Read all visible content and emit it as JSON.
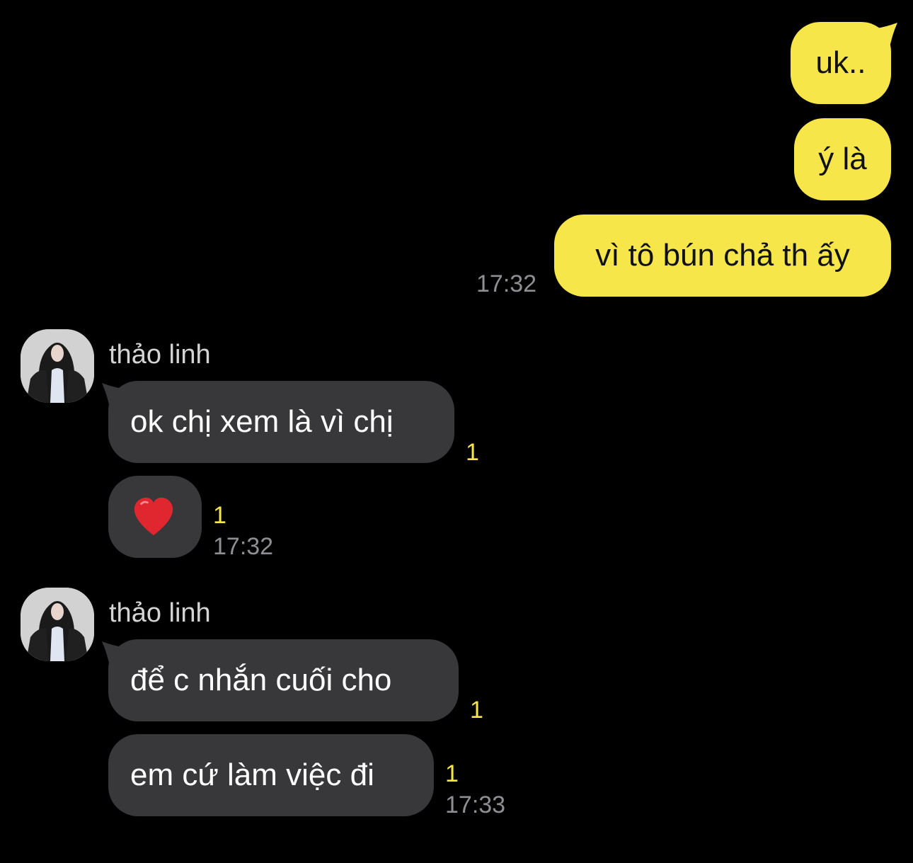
{
  "outgoing": [
    {
      "text": "uk.."
    },
    {
      "text": "ý là"
    },
    {
      "text": "vì tô bún chả th ấy"
    }
  ],
  "outgoing_time": "17:32",
  "groups": [
    {
      "sender": "thảo linh",
      "messages": [
        {
          "text": "ok chị xem là vì chị",
          "unread": "1"
        },
        {
          "emoji": "red-heart",
          "unread": "1"
        }
      ],
      "time": "17:32"
    },
    {
      "sender": "thảo linh",
      "messages": [
        {
          "text": "để c nhắn cuối cho",
          "unread": "1"
        },
        {
          "text": "em cứ làm việc đi",
          "unread": "1"
        }
      ],
      "time": "17:33"
    }
  ],
  "colors": {
    "background": "#000000",
    "outgoing_bubble": "#f7e64a",
    "incoming_bubble": "#38383a",
    "unread_count": "#f7e64a",
    "timestamp": "#8e8e93"
  }
}
